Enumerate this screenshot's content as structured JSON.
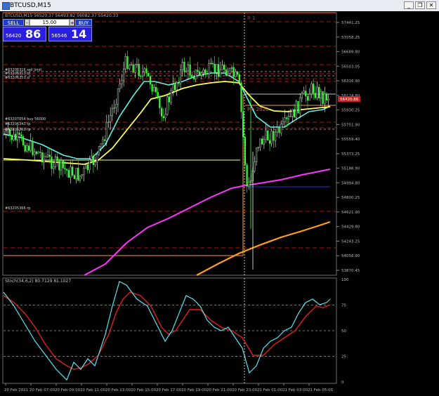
{
  "window": {
    "title": "BTCUSD,M15",
    "buttons": {
      "minimize": "_",
      "restore": "❐",
      "close": "✕"
    }
  },
  "symbol_line": "BTCUSD,M15  56520.37 56493.82 56082.37 55420.33",
  "trade_panel": {
    "sell_label": "SELL",
    "buy_label": "BUY",
    "lot_value": "15.00",
    "sell_small": "56420",
    "sell_big": "86",
    "buy_small": "56546",
    "buy_big": "14"
  },
  "price_labels": [
    "57441.25",
    "57058.25",
    "56689.80",
    "56503.05",
    "56316.90",
    "56124.80",
    "55930.25",
    "55751.90",
    "55559.40",
    "55373.25",
    "55186.90",
    "54994.80",
    "54800.25",
    "54621.90",
    "54429.80",
    "54243.25",
    "54056.90",
    "53870.45"
  ],
  "current_price": "56420.86",
  "time_labels": [
    "20 Feb 2021",
    "20 Feb 07:00",
    "20 Feb 09:00",
    "20 Feb 11:00",
    "20 Feb 13:00",
    "20 Feb 15:00",
    "20 Feb 17:00",
    "20 Feb 19:00",
    "20 Feb 21:00",
    "20 Feb 23:00",
    "21 Feb 01:00",
    "21 Feb 03:00",
    "21 Feb 05:00"
  ],
  "vline_label": "R 1",
  "order_labels": [
    "#63206316 sell limit",
    "#63206313 tp",
    "#63206353 sl",
    "#63207054 buy 56000",
    "#63206343 tp",
    "#63205362 rp",
    "#63205366 rp"
  ],
  "bar_label": "Pin 2020",
  "stoch": {
    "header": "Stoch(34,6,2) 80.7129 81.1027",
    "levels": [
      "100",
      "75",
      "50",
      "25",
      "0"
    ]
  },
  "colors": {
    "bull_candle": "#e8ffe8",
    "bear_candle": "#3bff3b",
    "ma_fast": "#5ff2e6",
    "ma_mid": "#ffff55",
    "ma_slow": "#ff33ff",
    "ma_long": "#ffa020",
    "level_line": "#b01010",
    "stoch_main": "#55e6f0",
    "stoch_signal": "#e02020"
  }
}
